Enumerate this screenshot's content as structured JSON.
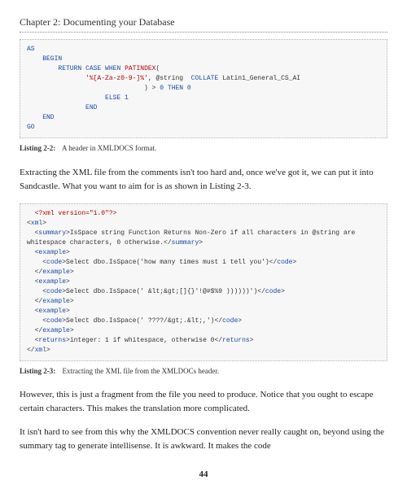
{
  "chapter": {
    "title": "Chapter 2: Documenting your Database"
  },
  "code1": {
    "l1a": "AS",
    "l2a": "BEGIN",
    "l3a": "RETURN",
    "l3b": "CASE",
    "l3c": "WHEN",
    "l3d": "PATINDEX",
    "l3e": "(",
    "l4a": "'%[A-Za-z0-9-]%'",
    "l4b": ",",
    "l4c": "@string",
    "l4d": "COLLATE",
    "l4e": "Latin1_General_CS_AI",
    "l5a": ")",
    "l5b": ">",
    "l5c": "0",
    "l5d": "THEN",
    "l5e": "0",
    "l6a": "ELSE",
    "l6b": "1",
    "l7a": "END",
    "l8a": "END",
    "l9a": "GO"
  },
  "listing22": {
    "label": "Listing 2-2:",
    "caption": "A header in XMLDOCS format."
  },
  "para1": "Extracting the XML file from the comments isn't too hard and, once we've got it, we can put it into Sandcastle. What you want to aim for is as shown in Listing 2-3.",
  "code2": {
    "xmlh": "<?xml version=\"1.0\"?>",
    "xml_open": "xml",
    "summary_open": "summary",
    "summary_text": "IsSpace string Function Returns Non-Zero if all characters in @string are whitespace characters, 0 otherwise.",
    "summary_close": "summary",
    "example": "example",
    "code": "code",
    "ex1_text": "Select dbo.IsSpace('how many times must i tell you')",
    "ex2_text": "Select dbo.IsSpace(' &lt;&gt;[]{}'!@#$%9 ))))))')",
    "ex3_text": "Select dbo.IsSpace(' ????/&gt;.&lt;,')",
    "returns": "returns",
    "returns_text": "integer: 1 if whitespace, otherwise 0",
    "xml_close": "xml"
  },
  "listing23": {
    "label": "Listing 2-3:",
    "caption": "Extracting the XML file from the XMLDOCs header."
  },
  "para2": "However, this is just a fragment from the file you need to produce. Notice that you ought to escape certain characters. This makes the translation more complicated.",
  "para3": "It isn't hard to see from this why the XMLDOCS convention never really caught on, beyond using the summary tag to generate intellisense. It is awkward. It makes the code",
  "pagenum": "44"
}
